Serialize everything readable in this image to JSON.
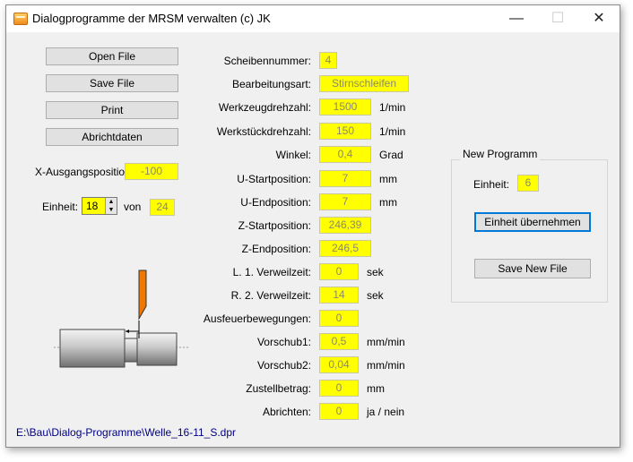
{
  "window": {
    "title": "Dialogprogramme der MRSM verwalten (c) JK",
    "controls": {
      "minimize": "—",
      "maximize": "☐",
      "close": "✕"
    }
  },
  "file_buttons": {
    "open": "Open File",
    "save": "Save File",
    "print": "Print",
    "abrichtdaten": "Abrichtdaten"
  },
  "left": {
    "x_ausgang_label": "X-Ausgangsposition:",
    "x_ausgang_value": "-100",
    "einheit_label": "Einheit:",
    "einheit_value": "18",
    "von_label": "von",
    "von_value": "24"
  },
  "params": [
    {
      "label": "Scheibennummer:",
      "value": "4",
      "unit": ""
    },
    {
      "label": "Bearbeitungsart:",
      "value": "Stirnschleifen",
      "unit": ""
    },
    {
      "label": "Werkzeugdrehzahl:",
      "value": "1500",
      "unit": "1/min"
    },
    {
      "label": "Werkstückdrehzahl:",
      "value": "150",
      "unit": "1/min"
    },
    {
      "label": "Winkel:",
      "value": "0,4",
      "unit": "Grad"
    },
    {
      "label": "U-Startposition:",
      "value": "7",
      "unit": "mm"
    },
    {
      "label": "U-Endposition:",
      "value": "7",
      "unit": "mm"
    },
    {
      "label": "Z-Startposition:",
      "value": "246,39",
      "unit": ""
    },
    {
      "label": "Z-Endposition:",
      "value": "246,5",
      "unit": ""
    },
    {
      "label": "L. 1. Verweilzeit:",
      "value": "0",
      "unit": "sek"
    },
    {
      "label": "R. 2. Verweilzeit:",
      "value": "14",
      "unit": "sek"
    },
    {
      "label": "Ausfeuerbewegungen:",
      "value": "0",
      "unit": ""
    },
    {
      "label": "Vorschub1:",
      "value": "0,5",
      "unit": "mm/min"
    },
    {
      "label": "Vorschub2:",
      "value": "0,04",
      "unit": "mm/min"
    },
    {
      "label": "Zustellbetrag:",
      "value": "0",
      "unit": "mm"
    },
    {
      "label": "Abrichten:",
      "value": "0",
      "unit": "ja / nein"
    }
  ],
  "new_programm": {
    "title": "New Programm",
    "einheit_label": "Einheit:",
    "einheit_value": "6",
    "apply_button": "Einheit übernehmen",
    "save_button": "Save New File"
  },
  "status": {
    "file_path": "E:\\Bau\\Dialog-Programme\\Welle_16-11_S.dpr"
  },
  "icons": {
    "app": "app-window-icon",
    "spinner_up": "spin-up-icon",
    "spinner_down": "spin-down-icon"
  },
  "colors": {
    "field_bg": "#ffff00",
    "field_text": "#8a8a6a",
    "tool": "#f07800",
    "path_text": "#000080"
  }
}
